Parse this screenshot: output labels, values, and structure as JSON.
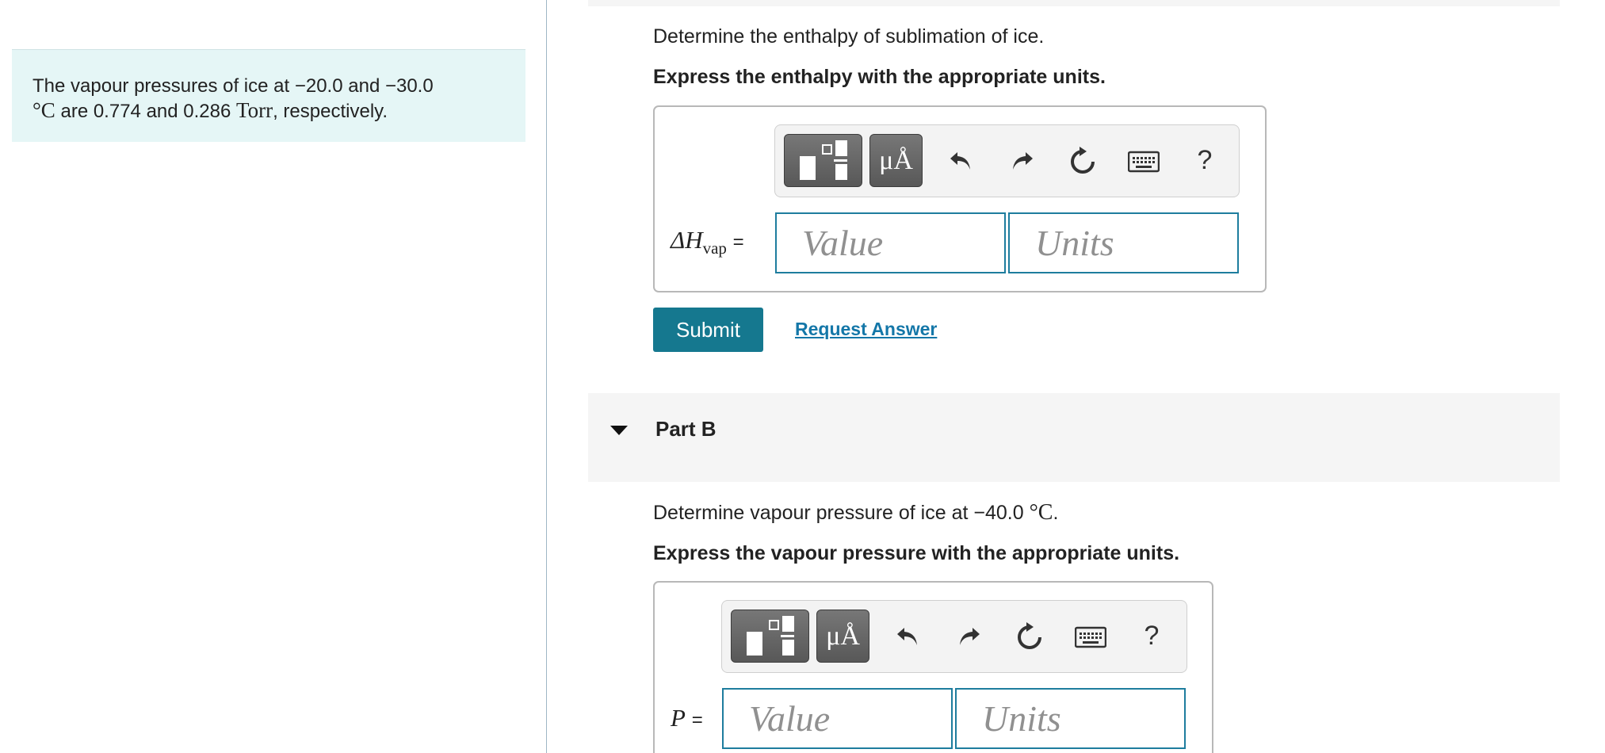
{
  "problem": {
    "prefix": "The vapour pressures of ice at ",
    "t1": "−20.0",
    "and1": " and ",
    "t2": "−30.0",
    "deg_unit": "°C",
    "mid": " are 0.774 and 0.286 ",
    "p_unit": "Torr",
    "suffix": ", respectively."
  },
  "partA": {
    "question": "Determine the enthalpy of sublimation of ice.",
    "instruction": "Express the enthalpy with the appropriate units.",
    "var_symbol": "ΔH",
    "var_sub": "vap",
    "equals": "=",
    "value_placeholder": "Value",
    "units_placeholder": "Units",
    "submit_label": "Submit",
    "request_label": "Request Answer"
  },
  "partB": {
    "title": "Part B",
    "question_prefix": "Determine vapour pressure of ice at ",
    "temp": "−40.0",
    "deg_unit": "°C",
    "question_suffix": ".",
    "instruction": "Express the vapour pressure with the appropriate units.",
    "var_symbol": "P",
    "equals": "=",
    "value_placeholder": "Value",
    "units_placeholder": "Units"
  },
  "toolbar": {
    "mu_label": "μÅ",
    "help_label": "?",
    "icons": [
      "templates-icon",
      "units-icon",
      "undo-icon",
      "redo-icon",
      "reset-icon",
      "keyboard-icon",
      "help-icon"
    ]
  },
  "colors": {
    "accent": "#15788f",
    "link": "#1477a8",
    "info_bg": "#e5f6f6",
    "field_border": "#1e7d9e"
  }
}
